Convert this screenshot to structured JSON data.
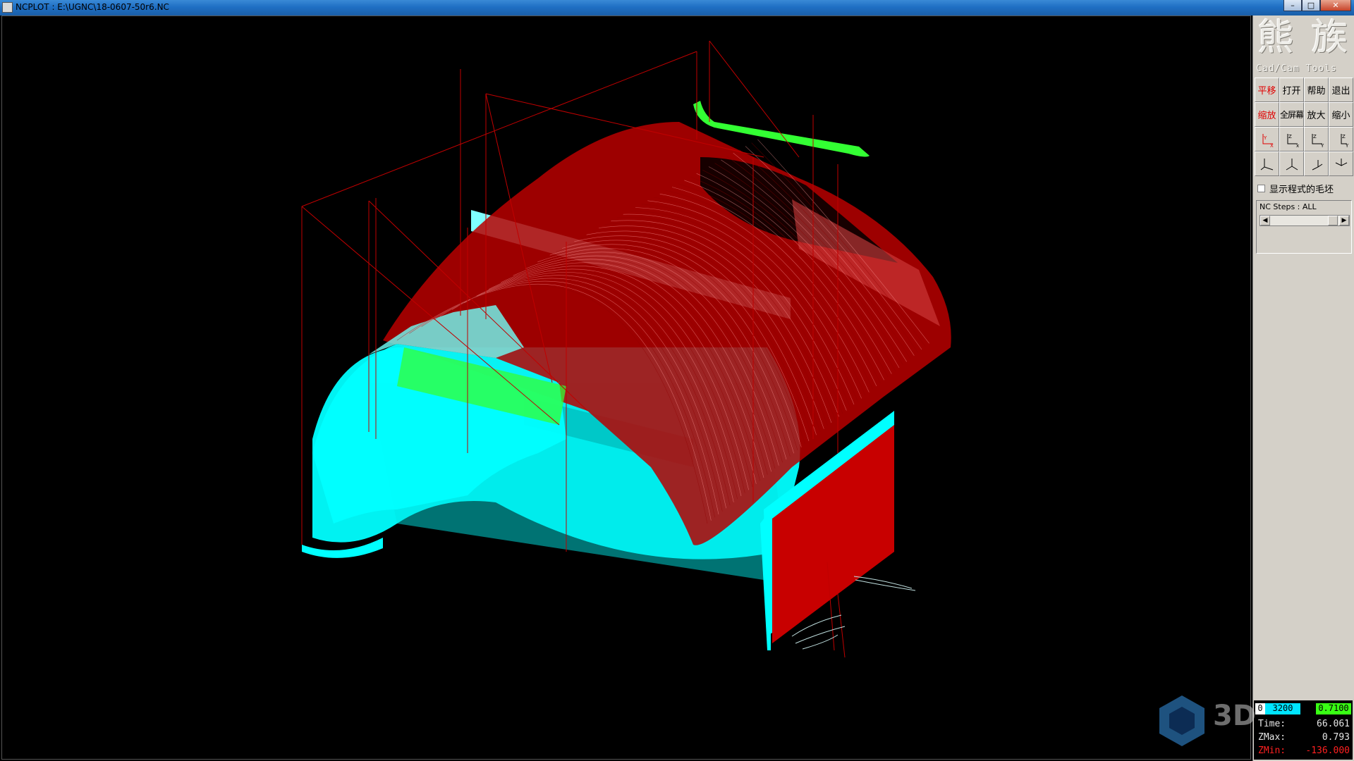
{
  "window": {
    "title": "NCPLOT : E:\\UGNC\\18-0607-50r6.NC",
    "buttons": {
      "minimize": "–",
      "maximize": "□",
      "close": "✕"
    }
  },
  "logo": {
    "chars": "熊 族",
    "subtitle": "Cad/Cam Tools"
  },
  "toolbar": {
    "row1": [
      "平移",
      "打开",
      "帮助",
      "退出"
    ],
    "row2": [
      "缩放",
      "全屏幕",
      "放大",
      "缩小"
    ],
    "view_icons": [
      "axes-xy-icon",
      "axes-xz-icon",
      "axes-yz-icon",
      "axes-zy-icon",
      "axes-iso1-icon",
      "axes-iso2-icon",
      "axes-iso3-icon",
      "axes-iso4-icon"
    ]
  },
  "options": {
    "show_stock_label": "显示程式的毛坯",
    "show_stock_checked": false
  },
  "nc_steps": {
    "label": "NC Steps : ALL"
  },
  "status": {
    "indicator_left": "0",
    "feed_cyan": "3200",
    "feed_green": "0.7100",
    "time_label": "Time:",
    "time_value": "66.061",
    "zmax_label": "ZMax:",
    "zmax_value": "0.793",
    "zmin_label": "ZMin:",
    "zmin_value": "-136.000"
  },
  "watermark": {
    "text": "3D"
  },
  "colors": {
    "background": "#000000",
    "toolpath_cyan": "#00ffff",
    "toolpath_red": "#c80000",
    "toolpath_green": "#33ff33",
    "panel": "#d4d0c8",
    "active_tool": "#e00000"
  }
}
